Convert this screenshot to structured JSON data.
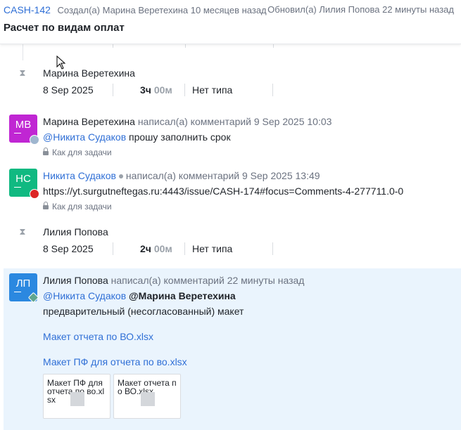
{
  "header": {
    "issue_id": "CASH-142",
    "created": "Создал(а) Марина Веретехина 10 месяцев назад",
    "updated": "Обновил(а) Лилия Попова 22 минуты назад",
    "title": "Расчет по видам оплат"
  },
  "worklogs": [
    {
      "author": "Марина Веретехина",
      "date": "8 Sep 2025",
      "hours": "3ч",
      "minutes": "00м",
      "type": "Нет типа"
    },
    {
      "author": "Лилия Попова",
      "date": "8 Sep 2025",
      "hours": "2ч",
      "minutes": "00м",
      "type": "Нет типа"
    }
  ],
  "comments": [
    {
      "initials": "МВ",
      "avatar_color": "#c026d3",
      "author": "Марина Веретехина",
      "action": "написал(а) комментарий 9 Sep 2025 10:03",
      "mention": "@Никита Судаков",
      "text": "прошу заполнить срок",
      "visibility": "Как для задачи"
    },
    {
      "initials": "НС",
      "avatar_color": "#10b981",
      "author": "Никита Судаков",
      "action": "написал(а) комментарий 9 Sep 2025 13:49",
      "link": "https://yt.surgutneftegas.ru:4443/issue/CASH-174#focus=Comments-4-277711.0-0",
      "visibility": "Как для задачи"
    },
    {
      "initials": "ЛП",
      "avatar_color": "#2b88e0",
      "author": "Лилия Попова",
      "action": "написал(а) комментарий 22 минуты назад",
      "mention1": "@Никита Судаков",
      "mention2": "@Марина Веретехина",
      "text": "предварительный (несогласованный) макет",
      "attachments": [
        "Макет отчета по ВО.xlsx",
        "Макет ПФ для отчета по во.xlsx"
      ],
      "thumbs": [
        "Макет ПФ для отчета по во.xlsx",
        "Макет отчета по ВО.xlsx"
      ]
    }
  ],
  "colors": {
    "accent": "#2f6fd6",
    "highlight_bg": "#eaf4fd"
  }
}
